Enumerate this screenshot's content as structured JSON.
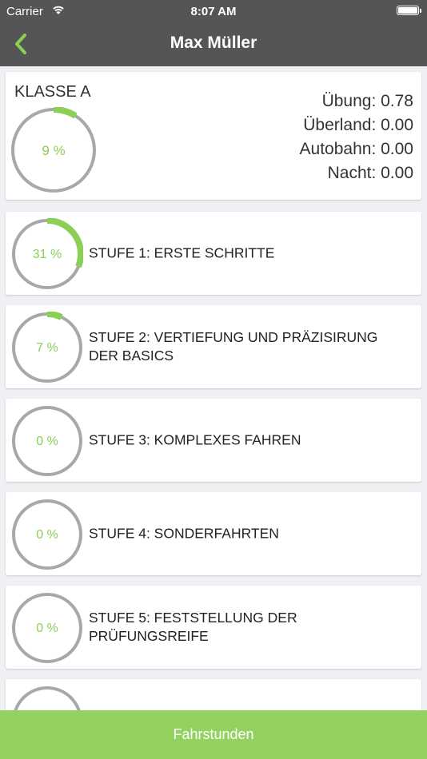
{
  "status_bar": {
    "carrier": "Carrier",
    "time": "8:07 AM"
  },
  "nav": {
    "title": "Max Müller",
    "back_icon": "chevron-left-icon"
  },
  "summary": {
    "class_label": "KLASSE A",
    "progress_percent": 9,
    "progress_text": "9 %",
    "stats": [
      {
        "text": "Übung: 0.78"
      },
      {
        "text": "Überland: 0.00"
      },
      {
        "text": "Autobahn: 0.00"
      },
      {
        "text": "Nacht: 0.00"
      }
    ]
  },
  "stages": [
    {
      "progress_percent": 31,
      "progress_text": "31 %",
      "title": "STUFE 1: ERSTE SCHRITTE"
    },
    {
      "progress_percent": 7,
      "progress_text": "7 %",
      "title": "STUFE 2: VERTIEFUNG UND PRÄZISIRUNG DER BASICS"
    },
    {
      "progress_percent": 0,
      "progress_text": "0 %",
      "title": "STUFE 3: KOMPLEXES FAHREN"
    },
    {
      "progress_percent": 0,
      "progress_text": "0 %",
      "title": "STUFE 4: SONDERFAHRTEN"
    },
    {
      "progress_percent": 0,
      "progress_text": "0 %",
      "title": "STUFE 5: FESTSTELLUNG DER PRÜFUNGSREIFE"
    },
    {
      "progress_percent": 0,
      "progress_text": "",
      "title": ""
    }
  ],
  "bottom_button": {
    "label": "Fahrstunden"
  },
  "colors": {
    "bar": "#555555",
    "accent": "#8bcf55",
    "button": "#93d160",
    "ring_track": "#a8a8a8",
    "background": "#efeff4"
  }
}
